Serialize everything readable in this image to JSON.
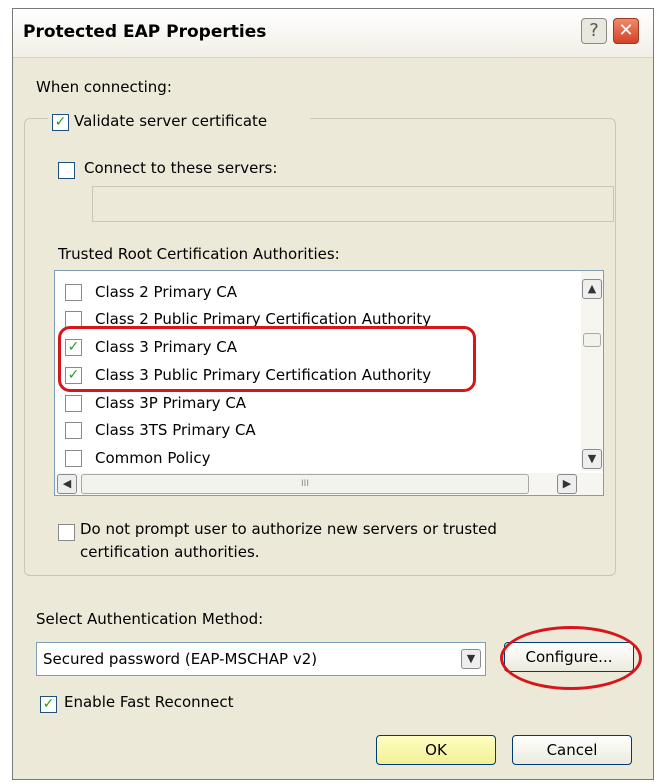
{
  "dialog": {
    "title": "Protected EAP Properties",
    "help_glyph": "?",
    "close_glyph": "✕"
  },
  "when_connecting_label": "When connecting:",
  "validate_server_certificate": {
    "label": "Validate server certificate",
    "checked": true
  },
  "connect_to_servers": {
    "label": "Connect to these servers:",
    "checked": false,
    "value": ""
  },
  "trusted_roots_label": "Trusted Root Certification Authorities:",
  "cert_list": [
    {
      "label": "Class 2 Primary CA",
      "checked": false
    },
    {
      "label": "Class 2 Public Primary Certification Authority",
      "checked": false
    },
    {
      "label": "Class 3 Primary CA",
      "checked": true
    },
    {
      "label": "Class 3 Public Primary Certification Authority",
      "checked": true
    },
    {
      "label": "Class 3P Primary CA",
      "checked": false
    },
    {
      "label": "Class 3TS Primary CA",
      "checked": false
    },
    {
      "label": "Common Policy",
      "checked": false
    }
  ],
  "scroll_glyphs": {
    "up": "▲",
    "down": "▼",
    "left": "◀",
    "right": "▶",
    "grip": "III"
  },
  "do_not_prompt": {
    "line1": "Do not prompt user to authorize new servers or trusted",
    "line2": "certification authorities.",
    "checked": false
  },
  "auth_method_label": "Select Authentication Method:",
  "auth_method_value": "Secured password (EAP-MSCHAP v2)",
  "configure_button": "Configure...",
  "fast_reconnect": {
    "label": "Enable Fast Reconnect",
    "checked": true
  },
  "ok_button": "OK",
  "cancel_button": "Cancel",
  "colors": {
    "annotation_red": "#d6161b",
    "check_green": "#21a121"
  }
}
